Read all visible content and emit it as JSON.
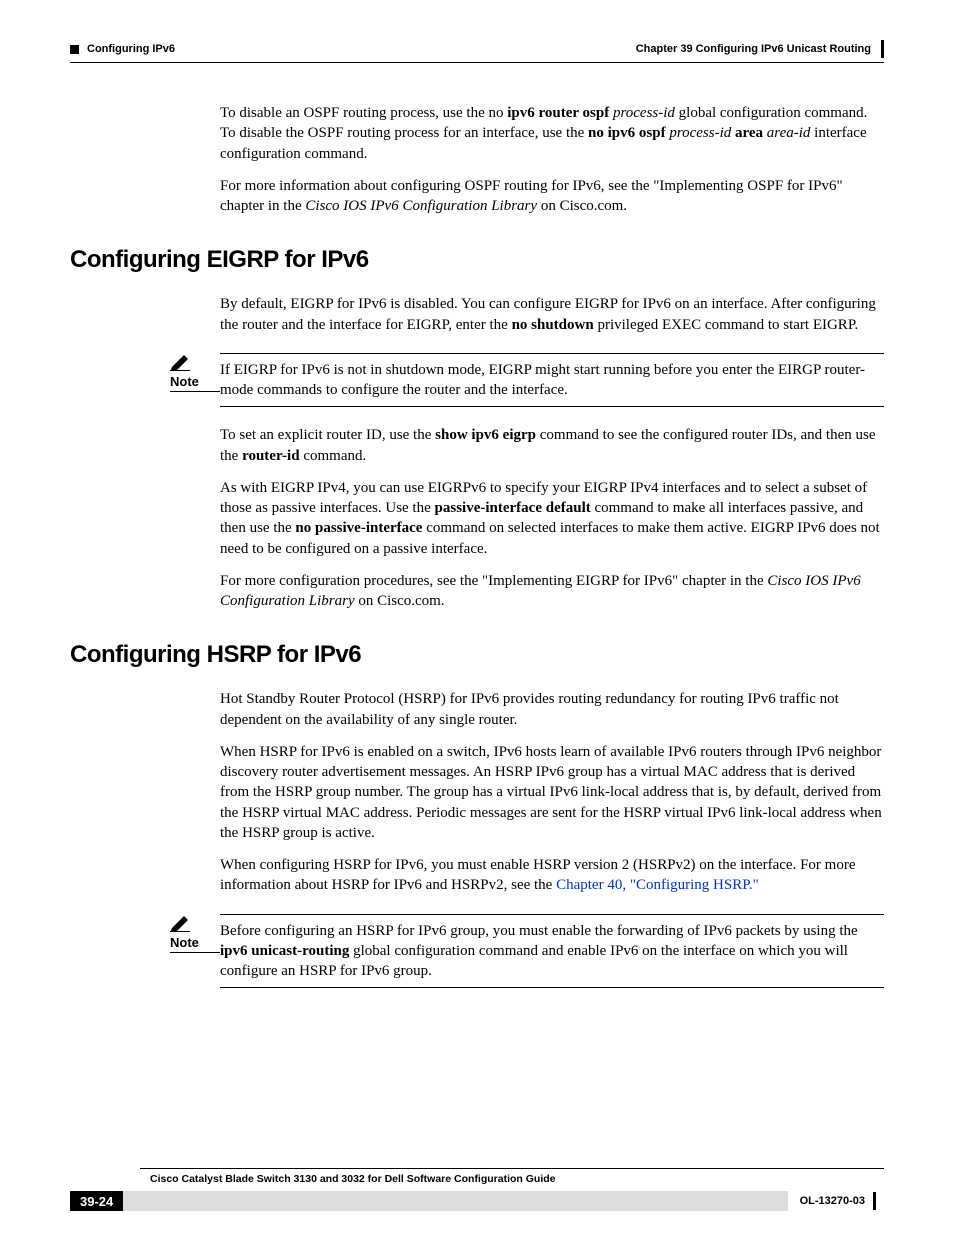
{
  "header": {
    "section": "Configuring IPv6",
    "chapter": "Chapter 39    Configuring IPv6 Unicast Routing"
  },
  "sec1": {
    "p1a": "To disable an OSPF routing process, use the no ",
    "p1b": "ipv6 router ospf",
    "p1c": " ",
    "p1d": "process-id",
    "p1e": " global configuration command. To disable the OSPF routing process for an interface, use the ",
    "p1f": "no ipv6 ospf",
    "p1g": " ",
    "p1h": "process-id",
    "p1i": " ",
    "p1j": "area",
    "p1k": " ",
    "p1l": "area-id",
    "p1m": " interface configuration command.",
    "p2a": "For more information about configuring OSPF routing for IPv6, see the \"Implementing OSPF for IPv6\" chapter in the ",
    "p2b": "Cisco IOS IPv6 Configuration Library",
    "p2c": " on Cisco.com."
  },
  "h2a": "Configuring EIGRP for IPv6",
  "sec2": {
    "p1a": "By default, EIGRP for IPv6 is disabled. You can configure EIGRP for IPv6 on an interface. After configuring the router and the interface for EIGRP, enter the ",
    "p1b": "no shutdown",
    "p1c": " privileged EXEC command to start EIGRP.",
    "note1": "If EIGRP for IPv6 is not in shutdown mode, EIGRP might start running before you enter the EIRGP router-mode commands to configure the router and the interface.",
    "p2a": "To set an explicit router ID, use the ",
    "p2b": "show ipv6 eigrp",
    "p2c": " command to see the configured router IDs, and then use the ",
    "p2d": "router-id",
    "p2e": " command.",
    "p3a": "As with EIGRP IPv4, you can use EIGRPv6 to specify your EIGRP IPv4 interfaces and to select a subset of those as passive interfaces. Use the ",
    "p3b": "passive-interface default",
    "p3c": " command to make all interfaces passive, and then use the ",
    "p3d": "no passive-interface",
    "p3e": " command on selected interfaces to make them active. EIGRP IPv6 does not need to be configured on a passive interface.",
    "p4a": "For more configuration procedures, see the \"Implementing EIGRP for IPv6\" chapter in the ",
    "p4b": "Cisco IOS IPv6 Configuration Library",
    "p4c": " on Cisco.com."
  },
  "h2b": "Configuring HSRP for IPv6",
  "sec3": {
    "p1": "Hot Standby Router Protocol (HSRP) for IPv6 provides routing redundancy for routing IPv6 traffic not dependent on the availability of any single router.",
    "p2": "When HSRP for IPv6 is enabled on a switch, IPv6 hosts learn of available IPv6 routers through IPv6 neighbor discovery router advertisement messages. An HSRP IPv6 group has a virtual MAC address that is derived from the HSRP group number. The group has a virtual IPv6 link-local address that is, by default, derived from the HSRP virtual MAC address. Periodic messages are sent for the HSRP virtual IPv6 link-local address when the HSRP group is active.",
    "p3a": "When configuring HSRP for IPv6, you must enable HSRP version 2 (HSRPv2) on the interface. For more information about HSRP for IPv6 and HSRPv2, see the ",
    "p3b": "Chapter 40, \"Configuring HSRP.\"",
    "note2a": "Before configuring an HSRP for IPv6 group, you must enable the forwarding of IPv6 packets by using the ",
    "note2b": "ipv6 unicast-routing",
    "note2c": " global configuration command and enable IPv6 on the interface on which you will configure an HSRP for IPv6 group."
  },
  "labels": {
    "note": "Note"
  },
  "footer": {
    "title": "Cisco Catalyst Blade Switch 3130 and 3032 for Dell Software Configuration Guide",
    "page": "39-24",
    "code": "OL-13270-03"
  }
}
